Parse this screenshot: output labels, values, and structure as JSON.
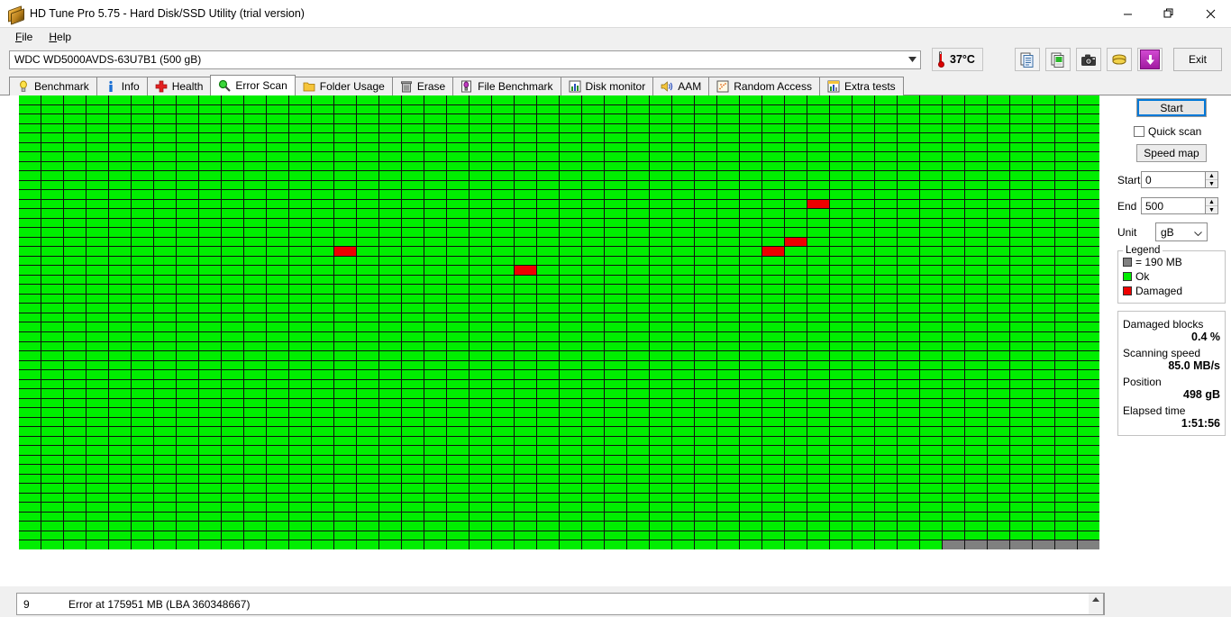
{
  "window": {
    "title": "HD Tune Pro 5.75 - Hard Disk/SSD Utility (trial version)",
    "icon": "hard-disk-icon",
    "minimize": "—",
    "maximize": "❑",
    "close": "✕"
  },
  "menu": {
    "items": [
      {
        "label": "File",
        "accel": "F"
      },
      {
        "label": "Help",
        "accel": "H"
      }
    ]
  },
  "device": {
    "selected": "WDC WD5000AVDS-63U7B1 (500 gB)",
    "dropdown_arrow": "▼"
  },
  "temperature": {
    "value": "37°C",
    "icon": "thermometer-icon"
  },
  "toolbar": {
    "buttons": [
      {
        "name": "copy-to-clipboard-button",
        "icon": "copy-icon"
      },
      {
        "name": "copy-image-button",
        "icon": "copy-image-icon"
      },
      {
        "name": "screenshot-button",
        "icon": "camera-icon"
      },
      {
        "name": "buy-license-button",
        "icon": "money-icon"
      },
      {
        "name": "download-button",
        "icon": "download-arrow-icon"
      }
    ],
    "exit_label": "Exit"
  },
  "tabs": [
    {
      "label": "Benchmark",
      "icon": "lightbulb-icon",
      "active": false
    },
    {
      "label": "Info",
      "icon": "info-icon",
      "active": false
    },
    {
      "label": "Health",
      "icon": "health-cross-icon",
      "active": false
    },
    {
      "label": "Error Scan",
      "icon": "magnifier-icon",
      "active": true
    },
    {
      "label": "Folder Usage",
      "icon": "folder-icon",
      "active": false
    },
    {
      "label": "Erase",
      "icon": "trash-icon",
      "active": false
    },
    {
      "label": "File Benchmark",
      "icon": "file-benchmark-icon",
      "active": false
    },
    {
      "label": "Disk monitor",
      "icon": "bar-chart-icon",
      "active": false
    },
    {
      "label": "AAM",
      "icon": "speaker-icon",
      "active": false
    },
    {
      "label": "Random Access",
      "icon": "scatter-icon",
      "active": false
    },
    {
      "label": "Extra tests",
      "icon": "extra-tests-icon",
      "active": false
    }
  ],
  "controls": {
    "start_label": "Start",
    "quick_scan_label": "Quick scan",
    "quick_scan_checked": false,
    "speed_map_label": "Speed map",
    "start_field_label": "Start",
    "start_field_value": "0",
    "end_field_label": "End",
    "end_field_value": "500",
    "unit_label": "Unit",
    "unit_value": "gB",
    "spinner_up": "▲",
    "spinner_down": "▼",
    "select_arrow": "∨"
  },
  "legend": {
    "title": "Legend",
    "block_size": "= 190 MB",
    "ok_label": "Ok",
    "damaged_label": "Damaged",
    "colors": {
      "ok": "#00ee00",
      "damaged": "#ee0000",
      "unscanned": "#808080",
      "grid_line": "#111111"
    }
  },
  "stats": {
    "damaged_blocks_label": "Damaged blocks",
    "damaged_blocks_value": "0.4 %",
    "scanning_speed_label": "Scanning speed",
    "scanning_speed_value": "85.0 MB/s",
    "position_label": "Position",
    "position_value": "498 gB",
    "elapsed_time_label": "Elapsed time",
    "elapsed_time_value": "1:51:56"
  },
  "error_list": {
    "rows": [
      {
        "index": "9",
        "message": "Error at 175951 MB (LBA 360348667)"
      }
    ],
    "scroll_up": "▲"
  },
  "chart_data": {
    "type": "heatmap",
    "title": "Error Scan block map",
    "columns": 48,
    "rows": 48,
    "block_size_mb": 190,
    "states": [
      "ok",
      "damaged",
      "unscanned"
    ],
    "state_colors": {
      "ok": "#00ee00",
      "damaged": "#ee0000",
      "unscanned": "#808080"
    },
    "default_state": "ok",
    "damaged_cells": [
      {
        "row": 11,
        "col": 35
      },
      {
        "row": 15,
        "col": 34
      },
      {
        "row": 16,
        "col": 33
      },
      {
        "row": 16,
        "col": 14
      },
      {
        "row": 18,
        "col": 22
      }
    ],
    "unscanned_cells_last_row": {
      "row": 47,
      "from_col": 41,
      "to_col": 47
    },
    "damaged_percent": 0.4,
    "position_gb": 498,
    "total_gb": 500
  }
}
